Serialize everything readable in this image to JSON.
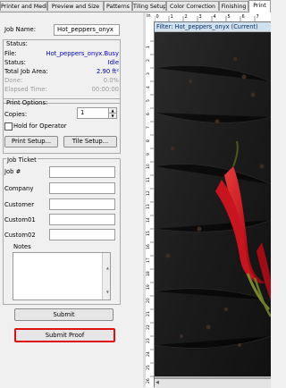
{
  "tabs": [
    "Printer and Media",
    "Preview and Size",
    "Patterns",
    "Tiling Setup",
    "Color Correction",
    "Finishing",
    "Print"
  ],
  "active_tab": "Print",
  "job_name": {
    "label": "Job Name:",
    "value": "Hot_peppers_onyx"
  },
  "status": {
    "title": "Status:",
    "file_label": "File:",
    "file_value": "Hot_peppers_onyx.Busy",
    "status_label": "Status:",
    "status_value": "Idle",
    "area_label": "Total Job Area:",
    "area_value": "2.90 ft²",
    "done_label": "Done:",
    "done_value": "0.0%",
    "elapsed_label": "Elapsed Time:",
    "elapsed_value": "00:00:00"
  },
  "print_options": {
    "title": "Print Options:",
    "copies_label": "Copies:",
    "copies_value": "1",
    "hold_label": "Hold for Operator",
    "print_setup": "Print Setup...",
    "tile_setup": "Tile Setup..."
  },
  "job_ticket": {
    "title": "Job Ticket",
    "fields": [
      "Job #",
      "Company",
      "Customer",
      "Custom01",
      "Custom02"
    ],
    "notes_label": "Notes"
  },
  "submit_label": "Submit",
  "submit_proof_label": "Submit Proof",
  "viewer": {
    "filter_title": "Filter: Hot_peppers_onyx (Current)",
    "ruler_unit": "in",
    "ruler_top": [
      "0",
      "1",
      "2",
      "3",
      "4",
      "5",
      "6",
      "7"
    ],
    "ruler_left": [
      "1",
      "2",
      "3",
      "4",
      "5",
      "6",
      "7",
      "8",
      "9",
      "10",
      "11",
      "12",
      "13",
      "14",
      "15",
      "16",
      "17",
      "18",
      "19",
      "20",
      "21",
      "22",
      "23",
      "24",
      "25",
      "26"
    ]
  },
  "colors": {
    "highlight": "#e01010",
    "link_blue": "#0000cc",
    "pepper_red": "#c8141e"
  }
}
